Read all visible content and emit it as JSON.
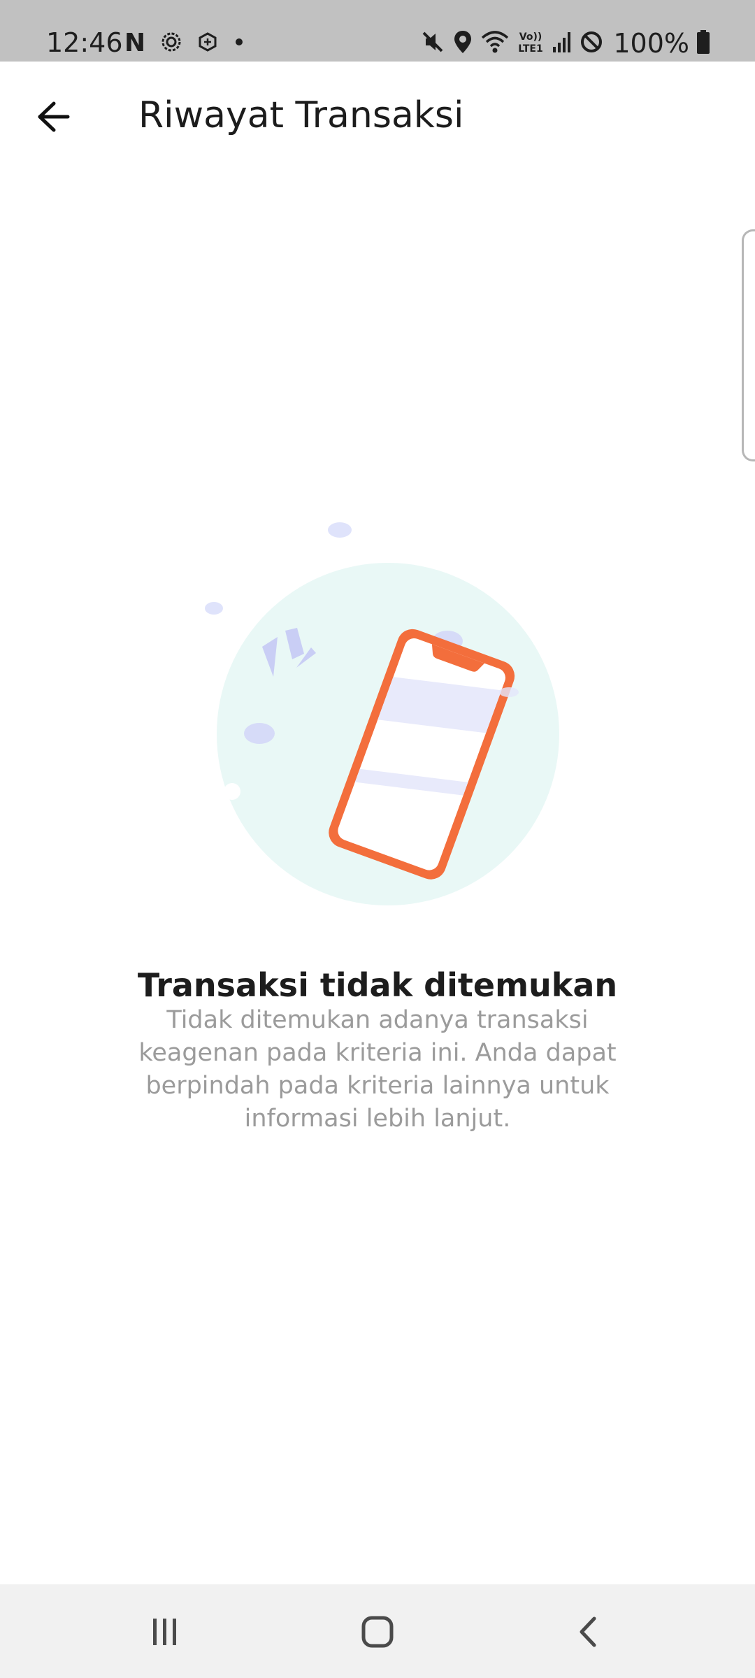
{
  "status_bar": {
    "time": "12:46",
    "battery": "100%",
    "network_label": "Vo)) LTE1",
    "icons": [
      "netflix-icon",
      "settings-cog-icon",
      "hex-app-icon",
      "dot-icon",
      "mute-icon",
      "location-icon",
      "wifi-icon",
      "lte-icon",
      "signal-icon",
      "block-icon",
      "battery-icon"
    ]
  },
  "app_bar": {
    "title": "Riwayat Transaksi",
    "back_icon": "arrow-left-icon"
  },
  "empty_state": {
    "title": "Transaksi tidak ditemukan",
    "description": "Tidak ditemukan adanya transaksi keagenan pada kriteria ini. Anda dapat berpindah pada kriteria lainnya untuk informasi lebih lanjut.",
    "illustration": "phone-illustration",
    "colors": {
      "circle": "#e9f8f6",
      "phone": "#f36e3c",
      "accent": "#e3e6fb",
      "sparks": "#c9cef5"
    }
  },
  "nav_bar": {
    "icons": [
      "recents-icon",
      "home-icon",
      "back-icon"
    ]
  }
}
